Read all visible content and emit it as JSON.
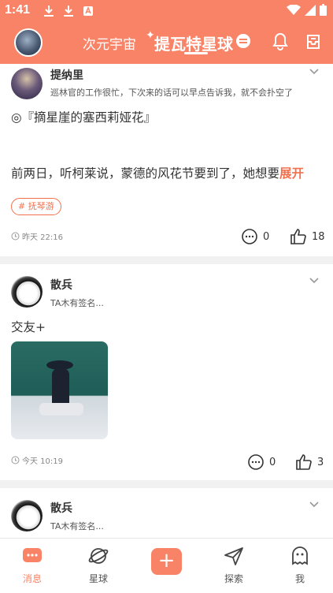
{
  "status_bar": {
    "time": "1:41"
  },
  "header": {
    "tab_universe": "次元宇宙",
    "tab_planet": "提瓦特星球"
  },
  "posts": [
    {
      "username": "提纳里",
      "signature": "巡林官的工作很忙，下次来的话可以早点告诉我，就不会扑空了",
      "line1": "◎『摘星崖的塞西莉娅花』",
      "line2": "前两日，听柯莱说，蒙德的风花节要到了，她想要",
      "expand": "展开",
      "tag": "# 抚琴游",
      "time": "昨天 22:16",
      "comments": "0",
      "likes": "18"
    },
    {
      "username": "散兵",
      "signature": "TA木有签名...",
      "line1": "交友+",
      "time": "今天 10:19",
      "comments": "0",
      "likes": "3"
    },
    {
      "username": "散兵",
      "signature": "TA木有签名..."
    }
  ],
  "bottom_nav": [
    {
      "label": "消息"
    },
    {
      "label": "星球"
    },
    {
      "label": "探索"
    },
    {
      "label": "我"
    }
  ],
  "colors": {
    "accent": "#f98367",
    "tag": "#f2714d"
  }
}
